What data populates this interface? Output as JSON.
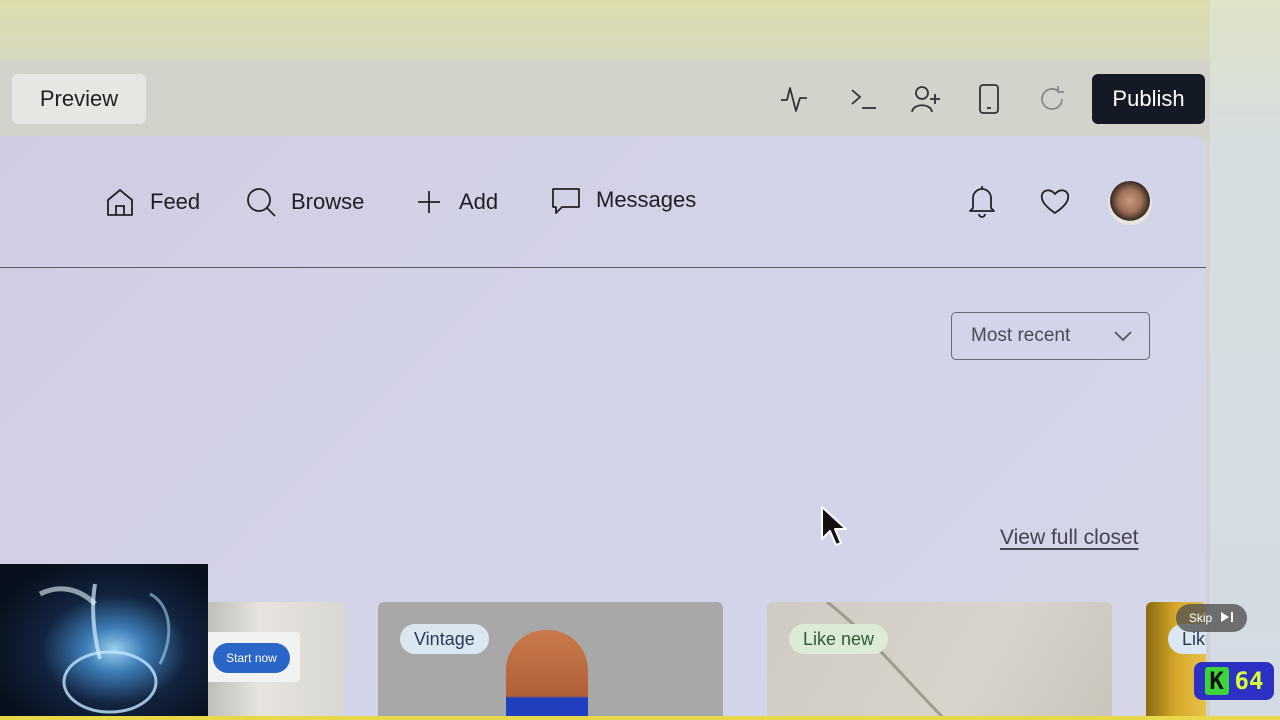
{
  "toolbar": {
    "preview_label": "Preview",
    "publish_label": "Publish",
    "tools": [
      "activity-icon",
      "terminal-icon",
      "add-user-icon",
      "mobile-device-icon",
      "refresh-icon"
    ]
  },
  "nav": {
    "items": [
      {
        "label": "Feed",
        "icon": "home-icon"
      },
      {
        "label": "Browse",
        "icon": "search-icon"
      },
      {
        "label": "Add",
        "icon": "plus-icon"
      },
      {
        "label": "Messages",
        "icon": "message-icon"
      }
    ],
    "right_icons": [
      "bell-icon",
      "heart-icon",
      "avatar"
    ]
  },
  "main": {
    "sort_label": "Most recent",
    "view_closet_label": "View full closet",
    "cards": [
      {
        "tag": ""
      },
      {
        "tag": "Vintage"
      },
      {
        "tag": "Like new"
      },
      {
        "tag": "Like"
      }
    ]
  },
  "overlay": {
    "ad_button_label": "Start now",
    "skip_label": "Skip",
    "badge_text": "64"
  },
  "colors": {
    "publish_bg": "#131a26",
    "accent_blue": "#2a66c8",
    "panel_bg": "#d3d3e8"
  }
}
